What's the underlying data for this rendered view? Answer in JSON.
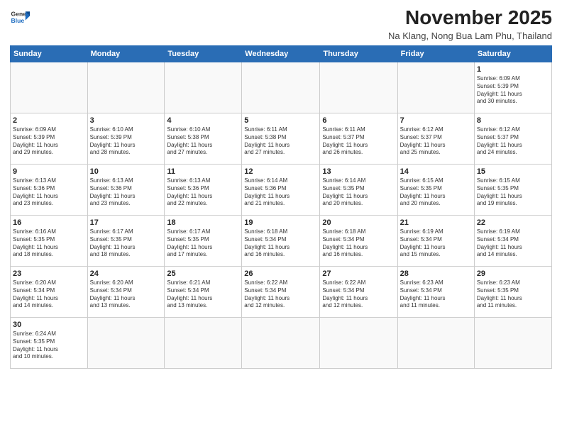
{
  "logo": {
    "general": "General",
    "blue": "Blue"
  },
  "title": "November 2025",
  "location": "Na Klang, Nong Bua Lam Phu, Thailand",
  "weekdays": [
    "Sunday",
    "Monday",
    "Tuesday",
    "Wednesday",
    "Thursday",
    "Friday",
    "Saturday"
  ],
  "weeks": [
    [
      {
        "day": "",
        "info": ""
      },
      {
        "day": "",
        "info": ""
      },
      {
        "day": "",
        "info": ""
      },
      {
        "day": "",
        "info": ""
      },
      {
        "day": "",
        "info": ""
      },
      {
        "day": "",
        "info": ""
      },
      {
        "day": "1",
        "info": "Sunrise: 6:09 AM\nSunset: 5:39 PM\nDaylight: 11 hours\nand 30 minutes."
      }
    ],
    [
      {
        "day": "2",
        "info": "Sunrise: 6:09 AM\nSunset: 5:39 PM\nDaylight: 11 hours\nand 29 minutes."
      },
      {
        "day": "3",
        "info": "Sunrise: 6:10 AM\nSunset: 5:39 PM\nDaylight: 11 hours\nand 28 minutes."
      },
      {
        "day": "4",
        "info": "Sunrise: 6:10 AM\nSunset: 5:38 PM\nDaylight: 11 hours\nand 27 minutes."
      },
      {
        "day": "5",
        "info": "Sunrise: 6:11 AM\nSunset: 5:38 PM\nDaylight: 11 hours\nand 27 minutes."
      },
      {
        "day": "6",
        "info": "Sunrise: 6:11 AM\nSunset: 5:37 PM\nDaylight: 11 hours\nand 26 minutes."
      },
      {
        "day": "7",
        "info": "Sunrise: 6:12 AM\nSunset: 5:37 PM\nDaylight: 11 hours\nand 25 minutes."
      },
      {
        "day": "8",
        "info": "Sunrise: 6:12 AM\nSunset: 5:37 PM\nDaylight: 11 hours\nand 24 minutes."
      }
    ],
    [
      {
        "day": "9",
        "info": "Sunrise: 6:13 AM\nSunset: 5:36 PM\nDaylight: 11 hours\nand 23 minutes."
      },
      {
        "day": "10",
        "info": "Sunrise: 6:13 AM\nSunset: 5:36 PM\nDaylight: 11 hours\nand 23 minutes."
      },
      {
        "day": "11",
        "info": "Sunrise: 6:13 AM\nSunset: 5:36 PM\nDaylight: 11 hours\nand 22 minutes."
      },
      {
        "day": "12",
        "info": "Sunrise: 6:14 AM\nSunset: 5:36 PM\nDaylight: 11 hours\nand 21 minutes."
      },
      {
        "day": "13",
        "info": "Sunrise: 6:14 AM\nSunset: 5:35 PM\nDaylight: 11 hours\nand 20 minutes."
      },
      {
        "day": "14",
        "info": "Sunrise: 6:15 AM\nSunset: 5:35 PM\nDaylight: 11 hours\nand 20 minutes."
      },
      {
        "day": "15",
        "info": "Sunrise: 6:15 AM\nSunset: 5:35 PM\nDaylight: 11 hours\nand 19 minutes."
      }
    ],
    [
      {
        "day": "16",
        "info": "Sunrise: 6:16 AM\nSunset: 5:35 PM\nDaylight: 11 hours\nand 18 minutes."
      },
      {
        "day": "17",
        "info": "Sunrise: 6:17 AM\nSunset: 5:35 PM\nDaylight: 11 hours\nand 18 minutes."
      },
      {
        "day": "18",
        "info": "Sunrise: 6:17 AM\nSunset: 5:35 PM\nDaylight: 11 hours\nand 17 minutes."
      },
      {
        "day": "19",
        "info": "Sunrise: 6:18 AM\nSunset: 5:34 PM\nDaylight: 11 hours\nand 16 minutes."
      },
      {
        "day": "20",
        "info": "Sunrise: 6:18 AM\nSunset: 5:34 PM\nDaylight: 11 hours\nand 16 minutes."
      },
      {
        "day": "21",
        "info": "Sunrise: 6:19 AM\nSunset: 5:34 PM\nDaylight: 11 hours\nand 15 minutes."
      },
      {
        "day": "22",
        "info": "Sunrise: 6:19 AM\nSunset: 5:34 PM\nDaylight: 11 hours\nand 14 minutes."
      }
    ],
    [
      {
        "day": "23",
        "info": "Sunrise: 6:20 AM\nSunset: 5:34 PM\nDaylight: 11 hours\nand 14 minutes."
      },
      {
        "day": "24",
        "info": "Sunrise: 6:20 AM\nSunset: 5:34 PM\nDaylight: 11 hours\nand 13 minutes."
      },
      {
        "day": "25",
        "info": "Sunrise: 6:21 AM\nSunset: 5:34 PM\nDaylight: 11 hours\nand 13 minutes."
      },
      {
        "day": "26",
        "info": "Sunrise: 6:22 AM\nSunset: 5:34 PM\nDaylight: 11 hours\nand 12 minutes."
      },
      {
        "day": "27",
        "info": "Sunrise: 6:22 AM\nSunset: 5:34 PM\nDaylight: 11 hours\nand 12 minutes."
      },
      {
        "day": "28",
        "info": "Sunrise: 6:23 AM\nSunset: 5:34 PM\nDaylight: 11 hours\nand 11 minutes."
      },
      {
        "day": "29",
        "info": "Sunrise: 6:23 AM\nSunset: 5:35 PM\nDaylight: 11 hours\nand 11 minutes."
      }
    ],
    [
      {
        "day": "30",
        "info": "Sunrise: 6:24 AM\nSunset: 5:35 PM\nDaylight: 11 hours\nand 10 minutes."
      },
      {
        "day": "",
        "info": ""
      },
      {
        "day": "",
        "info": ""
      },
      {
        "day": "",
        "info": ""
      },
      {
        "day": "",
        "info": ""
      },
      {
        "day": "",
        "info": ""
      },
      {
        "day": "",
        "info": ""
      }
    ]
  ]
}
